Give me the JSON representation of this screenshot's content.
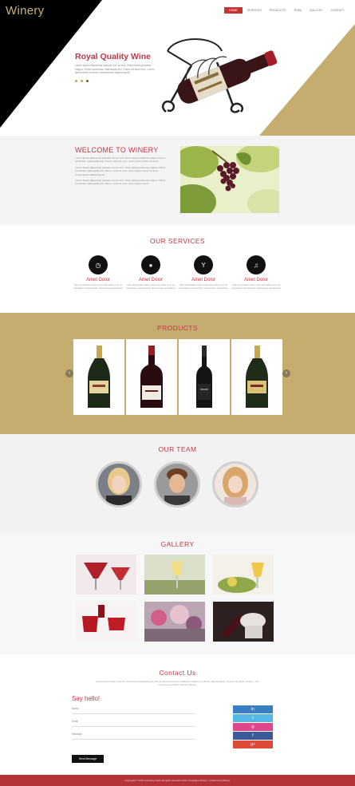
{
  "brand": {
    "logo": "Winery"
  },
  "nav": {
    "items": [
      {
        "label": "HOME",
        "active": true
      },
      {
        "label": "SERVICES",
        "active": false
      },
      {
        "label": "PRODUCTS",
        "active": false
      },
      {
        "label": "TEAM",
        "active": false
      },
      {
        "label": "GALLERY",
        "active": false
      },
      {
        "label": "CONTACT",
        "active": false
      }
    ]
  },
  "hero": {
    "title": "Royal Quality Wine",
    "text": "Lorem Ipsum Maecenas tristique orci ac sem. Duis ultrices pharetra magna. Donec accumsan malesuada orci. Donec sit amet eros. Lorem ipsum dolor sit amet, consectetuer adipiscing elit.",
    "slider_dots": 3
  },
  "welcome": {
    "title": "WELCOME TO WINERY",
    "paragraphs": [
      "Lorem Ipsum Maecenas tristique orci ac sem. Duis ultrices pharetra magna. Donec accumsan malesuada orci. Donec sit amet eros. Lorem ipsum dolor sit amet.",
      "Lorem Ipsum Maecenas tristique orci ac sem. Duis ultrices pharetra magna. Donec accumsan malesuada orci. Donec sit amet eros. Lorem ipsum dolor sit amet, consectetuer adipiscing elit.",
      "Lorem Ipsum Maecenas tristique orci ac sem. Duis ultrices pharetra magna. Donec accumsan malesuada orci. Donec sit amet eros. Lorem ipsum dolor."
    ]
  },
  "services": {
    "title": "OUR SERVICES",
    "items": [
      {
        "icon": "clock-icon",
        "glyph": "◷",
        "title": "Amet Dolor",
        "text": "Sed perspiciatis unde omnis iste natus error sit voluptatem accusantium doloremque laudantium"
      },
      {
        "icon": "user-icon",
        "glyph": "●",
        "title": "Amet Dolor",
        "text": "Sed perspiciatis unde omnis iste natus error sit voluptatem accusantium doloremque laudantium"
      },
      {
        "icon": "glass-icon",
        "glyph": "Y",
        "title": "Amet Dolor",
        "text": "Sed perspiciatis unde omnis iste natus error sit voluptatem accusantium doloremque laudantium"
      },
      {
        "icon": "music-icon",
        "glyph": "♫",
        "title": "Amet Dolor",
        "text": "Sed perspiciatis unde omnis iste natus error sit voluptatem accusantium doloremque laudantium"
      }
    ]
  },
  "products": {
    "title": "PRODUCTS",
    "items": [
      {
        "name": "champagne-bottle"
      },
      {
        "name": "red-wine-bottle"
      },
      {
        "name": "dark-wine-bottle"
      },
      {
        "name": "champagne-bottle-2"
      }
    ]
  },
  "team": {
    "title": "OUR TEAM"
  },
  "gallery": {
    "title": "GALLERY"
  },
  "contact": {
    "title": "Contact Us",
    "text": "Lorem ipsum dolor sit amet, consectetur adipiscing elit sed do eiusmod tempor incididunt ut labore et dolore magna aliqua. Ut enim ad minim veniam, quis nostrud exercitation ullamco laboris.",
    "form_title": "Say hello!",
    "name_label": "Name",
    "email_label": "Email",
    "message_label": "Message",
    "send_label": "Send Message"
  },
  "social": [
    {
      "icon": "linkedin-icon",
      "glyph": "in",
      "color": "#3a7fc1"
    },
    {
      "icon": "twitter-icon",
      "glyph": "t",
      "color": "#55b7e6"
    },
    {
      "icon": "dribbble-icon",
      "glyph": "◎",
      "color": "#e0468c"
    },
    {
      "icon": "facebook-icon",
      "glyph": "f",
      "color": "#3b5998"
    },
    {
      "icon": "google-plus-icon",
      "glyph": "g+",
      "color": "#dd4b39"
    }
  ],
  "footer": {
    "text": "Copyright © 2015 Company name All rights reserved. More Templates Winery - Collect from Winery"
  },
  "colors": {
    "accent": "#c0374a",
    "gold": "#c5ad70",
    "footer": "#b33338"
  }
}
